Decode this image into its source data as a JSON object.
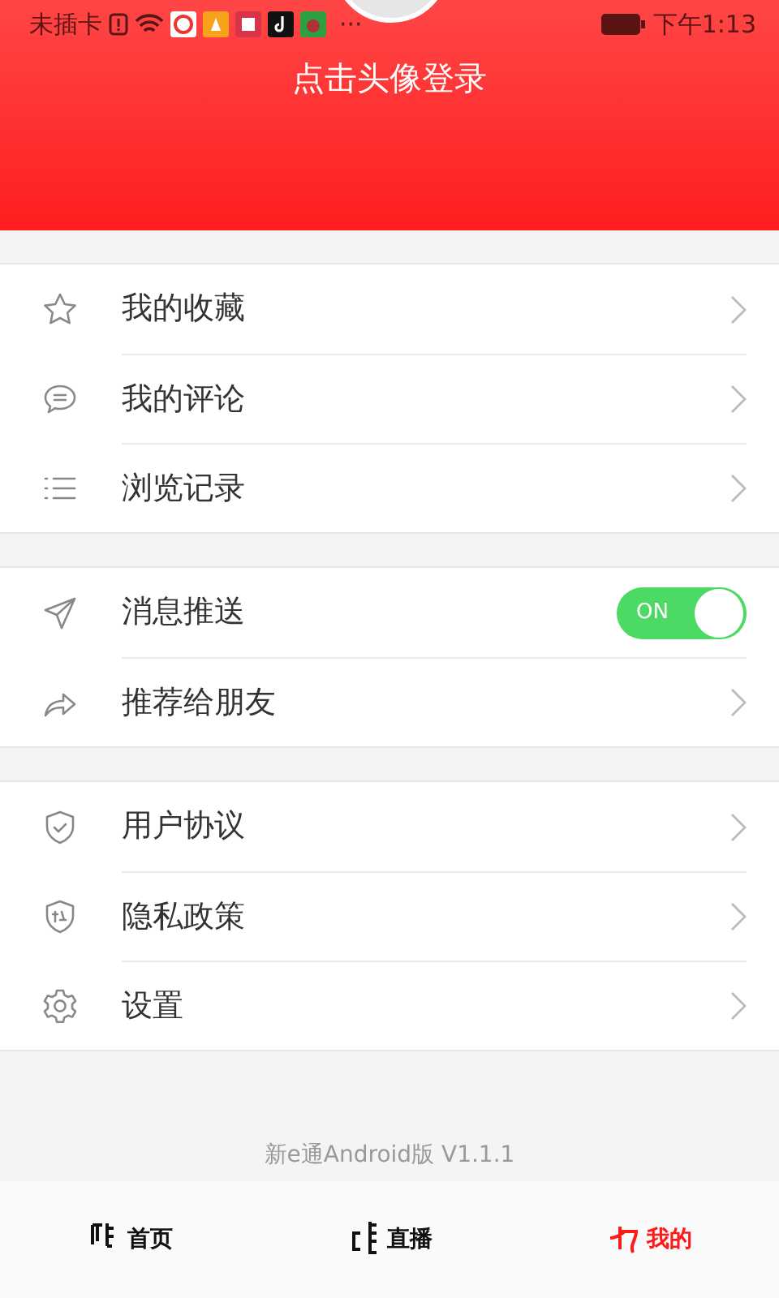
{
  "status_bar": {
    "carrier": "未插卡",
    "overflow": "···",
    "time": "下午1:13"
  },
  "header": {
    "login_prompt": "点击头像登录"
  },
  "sections": [
    [
      {
        "kind": "link",
        "label": "我的收藏"
      },
      {
        "kind": "link",
        "label": "我的评论"
      },
      {
        "kind": "link",
        "label": "浏览记录"
      }
    ],
    [
      {
        "kind": "toggle",
        "label": "消息推送",
        "on": true,
        "toggle_text": "ON"
      },
      {
        "kind": "link",
        "label": "推荐给朋友"
      }
    ],
    [
      {
        "kind": "link",
        "label": "用户协议"
      },
      {
        "kind": "link",
        "label": "隐私政策"
      },
      {
        "kind": "link",
        "label": "设置"
      }
    ]
  ],
  "version": "新e通Android版 V1.1.1",
  "tabs": [
    {
      "label": "首页",
      "selected": false
    },
    {
      "label": "直播",
      "selected": false
    },
    {
      "label": "我的",
      "selected": true
    }
  ]
}
